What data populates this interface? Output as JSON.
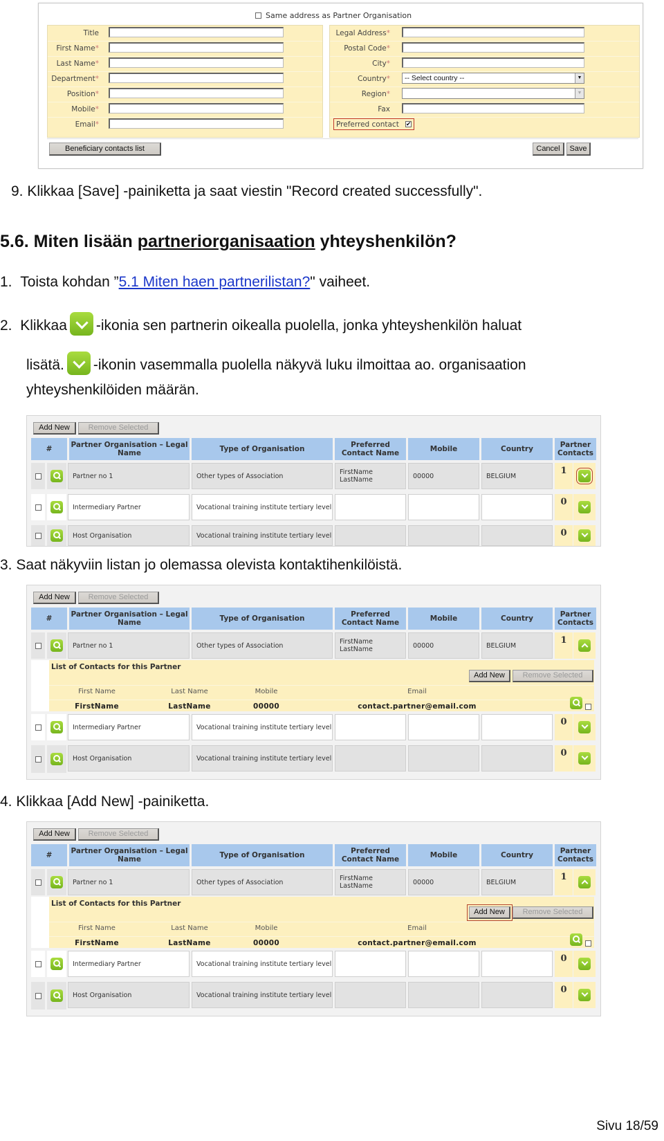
{
  "form": {
    "same_address_label": "Same address as Partner Organisation",
    "same_address_checked": false,
    "left_fields": [
      {
        "label": "Title",
        "required": false,
        "value": ""
      },
      {
        "label": "First Name",
        "required": true,
        "value": ""
      },
      {
        "label": "Last Name",
        "required": true,
        "value": ""
      },
      {
        "label": "Department",
        "required": true,
        "value": ""
      },
      {
        "label": "Position",
        "required": true,
        "value": ""
      },
      {
        "label": "Mobile",
        "required": true,
        "value": ""
      },
      {
        "label": "Email",
        "required": true,
        "value": ""
      }
    ],
    "right_fields": [
      {
        "label": "Legal Address",
        "required": true,
        "type": "text",
        "value": ""
      },
      {
        "label": "Postal Code",
        "required": true,
        "type": "text",
        "value": ""
      },
      {
        "label": "City",
        "required": true,
        "type": "text",
        "value": ""
      },
      {
        "label": "Country",
        "required": true,
        "type": "select",
        "value": "-- Select country --"
      },
      {
        "label": "Region",
        "required": true,
        "type": "select-disabled",
        "value": ""
      },
      {
        "label": "Fax",
        "required": false,
        "type": "text",
        "value": ""
      }
    ],
    "preferred_contact_label": "Preferred contact",
    "preferred_contact_checked": true,
    "required_marker": "*",
    "beneficiary_button": "Beneficiary contacts list",
    "cancel_button": "Cancel",
    "save_button": "Save"
  },
  "doc": {
    "step9": "9.  Klikkaa [Save] -painiketta ja saat viestin \"Record created successfully\".",
    "heading_prefix": "5.6. Miten lisään ",
    "heading_underlined": "partneriorganisaation",
    "heading_suffix": " yhteyshenkilön?",
    "step1_num": "1.",
    "step1_pre": "Toista kohdan ”",
    "step1_link": "5.1 Miten haen partnerilistan?",
    "step1_post": "\" vaiheet.",
    "step2_num": "2.",
    "step2_pre": "Klikkaa",
    "step2_post": "-ikonia sen partnerin oikealla puolella, jonka yhteyshenkilön haluat",
    "step2_line2_pre": "lisätä.",
    "step2_line2_post": "-ikonin vasemmalla puolella näkyvä luku ilmoittaa ao. organisaation",
    "step2_line3": "yhteyshenkilöiden määrän.",
    "step3": "3.  Saat näkyviin listan jo olemassa olevista kontaktihenkilöistä.",
    "step4": "4.  Klikkaa [Add New] -painiketta.",
    "footer": "Sivu 18/59"
  },
  "partner_table": {
    "add_new": "Add New",
    "remove_selected": "Remove Selected",
    "headers": {
      "hash": "#",
      "legal_name": "Partner Organisation – Legal Name",
      "type": "Type of Organisation",
      "preferred": "Preferred Contact Name",
      "mobile": "Mobile",
      "country": "Country",
      "contacts": "Partner Contacts"
    },
    "rows": [
      {
        "legal_name": "Partner no 1",
        "type": "Other types of Association",
        "preferred": "FirstName LastName",
        "mobile": "00000",
        "country": "BELGIUM",
        "contacts": "1"
      },
      {
        "legal_name": "Intermediary Partner",
        "type": "Vocational training institute tertiary level",
        "preferred": "",
        "mobile": "",
        "country": "",
        "contacts": "0"
      },
      {
        "legal_name": "Host Organisation",
        "type": "Vocational training institute tertiary level",
        "preferred": "",
        "mobile": "",
        "country": "",
        "contacts": "0"
      }
    ],
    "contacts_list": {
      "title": "List of Contacts for this Partner",
      "add_new": "Add New",
      "remove_selected": "Remove Selected",
      "headers": [
        "First Name",
        "Last Name",
        "Mobile",
        "Email"
      ],
      "rows": [
        {
          "first_name": "FirstName",
          "last_name": "LastName",
          "mobile": "00000",
          "email": "contact.partner@email.com"
        }
      ]
    }
  },
  "icons": {
    "expand": "chevron-down-icon",
    "collapse": "chevron-up-icon",
    "view": "magnifier-icon"
  },
  "colors": {
    "table_header": "#a8c8ec",
    "form_panel": "#fdf0bf",
    "icon_green": "#8cc63f",
    "highlight": "#b5452c",
    "link": "#1a36c9"
  }
}
